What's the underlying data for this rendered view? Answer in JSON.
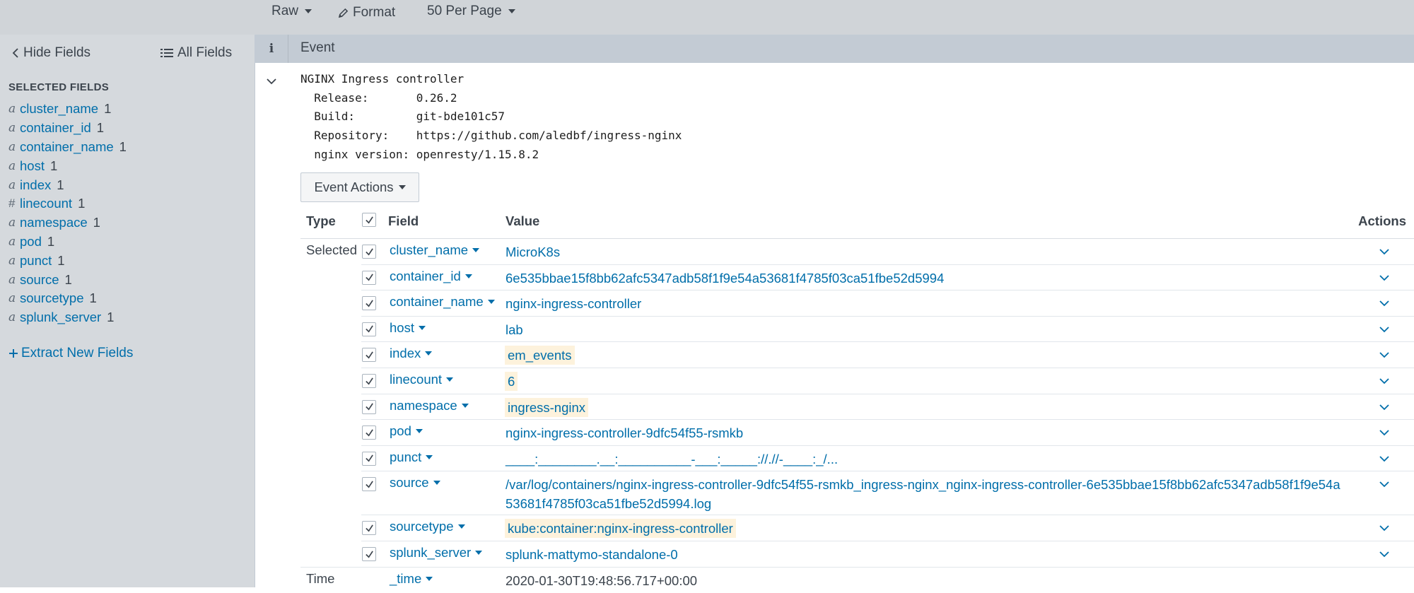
{
  "toolbar": {
    "raw_label": "Raw",
    "format_label": "Format",
    "per_page_label": "50 Per Page"
  },
  "sidebar": {
    "hide_fields_label": "Hide Fields",
    "all_fields_label": "All Fields",
    "heading": "SELECTED FIELDS",
    "fields": [
      {
        "type": "a",
        "name": "cluster_name",
        "count": "1"
      },
      {
        "type": "a",
        "name": "container_id",
        "count": "1"
      },
      {
        "type": "a",
        "name": "container_name",
        "count": "1"
      },
      {
        "type": "a",
        "name": "host",
        "count": "1"
      },
      {
        "type": "a",
        "name": "index",
        "count": "1"
      },
      {
        "type": "#",
        "name": "linecount",
        "count": "1"
      },
      {
        "type": "a",
        "name": "namespace",
        "count": "1"
      },
      {
        "type": "a",
        "name": "pod",
        "count": "1"
      },
      {
        "type": "a",
        "name": "punct",
        "count": "1"
      },
      {
        "type": "a",
        "name": "source",
        "count": "1"
      },
      {
        "type": "a",
        "name": "sourcetype",
        "count": "1"
      },
      {
        "type": "a",
        "name": "splunk_server",
        "count": "1"
      }
    ],
    "extract_label": "Extract New Fields"
  },
  "event": {
    "info_label": "i",
    "header_label": "Event",
    "raw_lines": [
      "NGINX Ingress controller",
      "  Release:       0.26.2",
      "  Build:         git-bde101c57",
      "  Repository:    https://github.com/aledbf/ingress-nginx",
      "  nginx version: openresty/1.15.8.2"
    ],
    "actions_label": "Event Actions"
  },
  "field_table": {
    "headers": {
      "type": "Type",
      "field": "Field",
      "value": "Value",
      "actions": "Actions"
    },
    "selected_label": "Selected",
    "time_label": "Time",
    "rows": [
      {
        "field": "cluster_name",
        "value": "MicroK8s",
        "highlight": false
      },
      {
        "field": "container_id",
        "value": "6e535bbae15f8bb62afc5347adb58f1f9e54a53681f4785f03ca51fbe52d5994",
        "highlight": false
      },
      {
        "field": "container_name",
        "value": "nginx-ingress-controller",
        "highlight": false
      },
      {
        "field": "host",
        "value": "lab",
        "highlight": false
      },
      {
        "field": "index",
        "value": "em_events",
        "highlight": true
      },
      {
        "field": "linecount",
        "value": "6",
        "highlight": true
      },
      {
        "field": "namespace",
        "value": "ingress-nginx",
        "highlight": true
      },
      {
        "field": "pod",
        "value": "nginx-ingress-controller-9dfc54f55-rsmkb",
        "highlight": false
      },
      {
        "field": "punct",
        "value": "____:________.__:__________-___:_____://.//-____:_/...",
        "highlight": false
      },
      {
        "field": "source",
        "value": "/var/log/containers/nginx-ingress-controller-9dfc54f55-rsmkb_ingress-nginx_nginx-ingress-controller-6e535bbae15f8bb62afc5347adb58f1f9e54a",
        "value2": "53681f4785f03ca51fbe52d5994.log",
        "highlight": false
      },
      {
        "field": "sourcetype",
        "value": "kube:container:nginx-ingress-controller",
        "highlight": true
      },
      {
        "field": "splunk_server",
        "value": "splunk-mattymo-standalone-0",
        "highlight": false
      }
    ],
    "time_row": {
      "field": "_time",
      "value": "2020-01-30T19:48:56.717+00:00"
    }
  }
}
